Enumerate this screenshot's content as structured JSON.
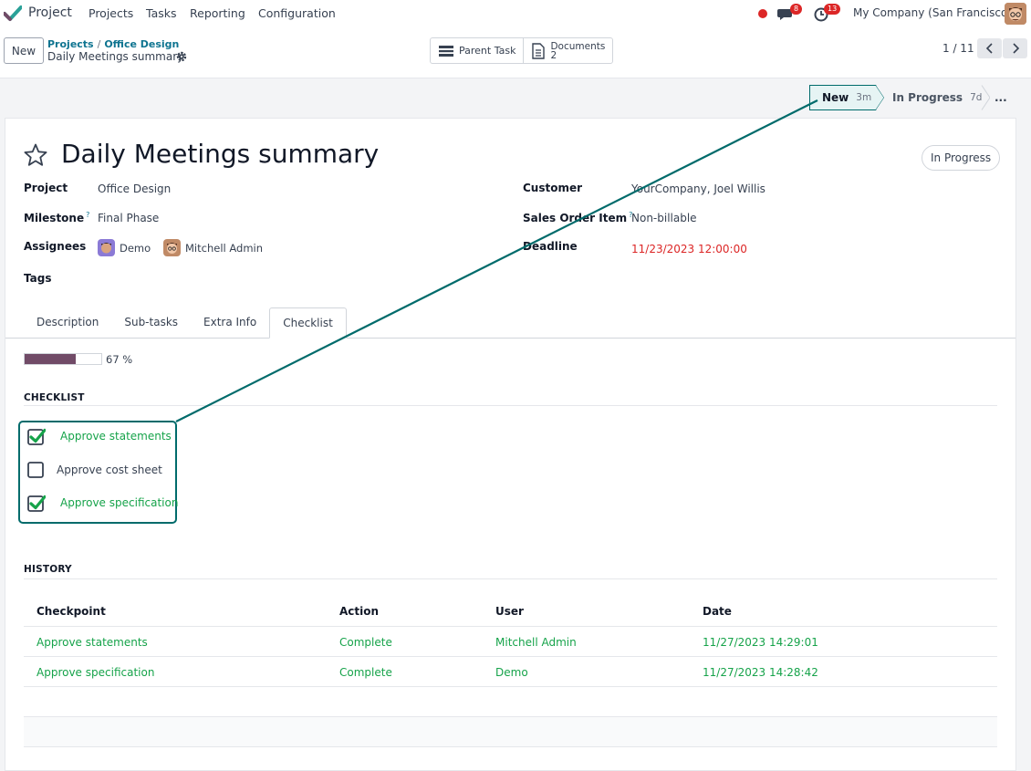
{
  "navbar": {
    "app_name": "Project",
    "menu": [
      "Projects",
      "Tasks",
      "Reporting",
      "Configuration"
    ],
    "messages_count": "8",
    "activities_count": "13",
    "company": "My Company (San Francisco)"
  },
  "control_panel": {
    "new_label": "New",
    "breadcrumb": [
      "Projects",
      "Office Design"
    ],
    "breadcrumb_sep": "/",
    "current": "Daily Meetings summary",
    "smart_buttons": {
      "parent_task": "Parent Task",
      "documents_label": "Documents",
      "documents_count": "2"
    },
    "pager": "1 / 11"
  },
  "statusbar": {
    "stages": [
      {
        "name": "New",
        "time": "3m"
      },
      {
        "name": "In Progress",
        "time": "7d"
      }
    ],
    "more": "..."
  },
  "form": {
    "title": "Daily Meetings summary",
    "state": "In Progress",
    "fields": {
      "project_label": "Project",
      "project_value": "Office Design",
      "milestone_label": "Milestone",
      "milestone_help": "?",
      "milestone_value": "Final Phase",
      "assignees_label": "Assignees",
      "assignees": [
        "Demo",
        "Mitchell Admin"
      ],
      "tags_label": "Tags",
      "customer_label": "Customer",
      "customer_value": "YourCompany, Joel Willis",
      "sales_order_label": "Sales Order Item",
      "sales_order_help": "?",
      "sales_order_value": "Non-billable",
      "deadline_label": "Deadline",
      "deadline_value": "11/23/2023 12:00:00"
    },
    "tabs": [
      "Description",
      "Sub-tasks",
      "Extra Info",
      "Checklist"
    ],
    "active_tab": "Checklist"
  },
  "checklist": {
    "progress": 67,
    "progress_label": "67 %",
    "section_title": "CHECKLIST",
    "items": [
      {
        "label": "Approve statements",
        "done": true
      },
      {
        "label": "Approve cost sheet",
        "done": false
      },
      {
        "label": "Approve specification",
        "done": true
      }
    ]
  },
  "history": {
    "section_title": "HISTORY",
    "columns": [
      "Checkpoint",
      "Action",
      "User",
      "Date"
    ],
    "rows": [
      [
        "Approve statements",
        "Complete",
        "Mitchell Admin",
        "11/27/2023 14:29:01"
      ],
      [
        "Approve specification",
        "Complete",
        "Demo",
        "11/27/2023 14:28:42"
      ]
    ]
  },
  "colors": {
    "accent": "#714b67",
    "link": "#0e7490",
    "done_text": "#16a34a",
    "deadline": "#dc2626",
    "callout": "#006b6b"
  }
}
